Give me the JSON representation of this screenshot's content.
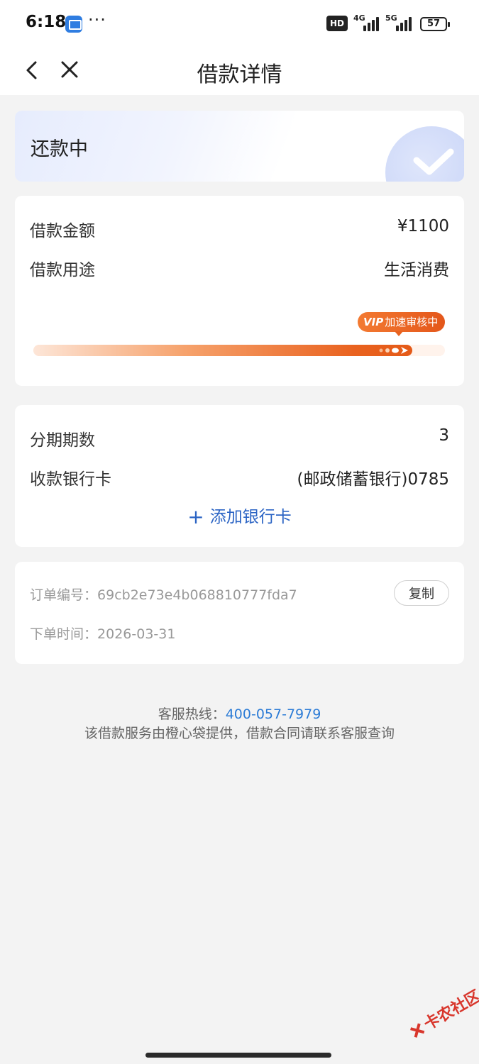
{
  "status_bar": {
    "time": "6:18",
    "more": "···",
    "hd": "HD",
    "net1": "4G",
    "net2": "5G",
    "battery": "57"
  },
  "nav": {
    "title": "借款详情",
    "back_icon": "chevron-left-icon",
    "close_icon": "close-icon"
  },
  "status": {
    "text": "还款中",
    "icon": "check-icon"
  },
  "loan": {
    "amount_label": "借款金额",
    "amount_value": "¥1100",
    "purpose_label": "借款用途",
    "purpose_value": "生活消费",
    "vip_tag": "VIP",
    "vip_text": "加速审核中",
    "progress": 0.92
  },
  "installment": {
    "periods_label": "分期期数",
    "periods_value": "3",
    "card_label": "收款银行卡",
    "card_value": "(邮政储蓄银行)0785",
    "add_card": "添加银行卡"
  },
  "order": {
    "number_label": "订单编号：",
    "number_value": "69cb2e73e4b068810777fda7",
    "copy": "复制",
    "time_label": "下单时间：",
    "time_value": "2026-03-31"
  },
  "footer": {
    "hotline_label": "客服热线：",
    "hotline": "400-057-7979",
    "note": "该借款服务由橙心袋提供，借款合同请联系客服查询"
  },
  "watermark": "卡农社区",
  "colors": {
    "accent_blue": "#2b64c4",
    "accent_orange": "#e9621f",
    "background": "#f3f3f3"
  }
}
